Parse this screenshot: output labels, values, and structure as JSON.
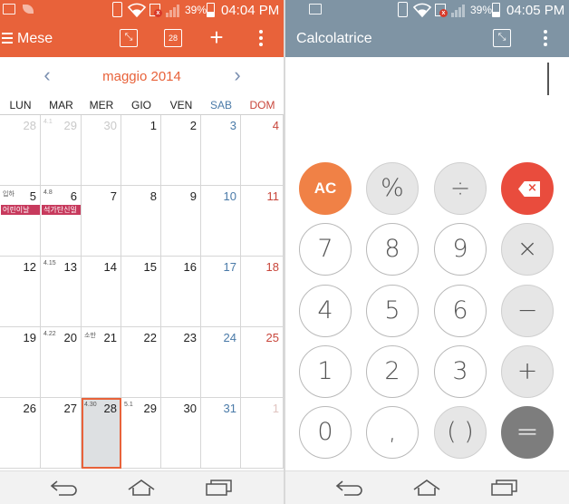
{
  "calendar_app": {
    "status": {
      "battery": "39%",
      "time": "04:04 PM"
    },
    "title": "Mese",
    "toolbar": {
      "today_badge": "28"
    },
    "month_label": "maggio 2014",
    "weekdays": [
      "LUN",
      "MAR",
      "MER",
      "GIO",
      "VEN",
      "SAB",
      "DOM"
    ],
    "weeks": [
      [
        {
          "d": "28",
          "other": true
        },
        {
          "d": "29",
          "other": true,
          "lunar": "4.1"
        },
        {
          "d": "30",
          "other": true
        },
        {
          "d": "1"
        },
        {
          "d": "2"
        },
        {
          "d": "3"
        },
        {
          "d": "4"
        }
      ],
      [
        {
          "d": "5",
          "lunar": "입하",
          "event": "어린이날"
        },
        {
          "d": "6",
          "lunar": "4.8",
          "event": "석가탄신일"
        },
        {
          "d": "7"
        },
        {
          "d": "8"
        },
        {
          "d": "9"
        },
        {
          "d": "10"
        },
        {
          "d": "11"
        }
      ],
      [
        {
          "d": "12"
        },
        {
          "d": "13",
          "lunar": "4.15"
        },
        {
          "d": "14"
        },
        {
          "d": "15"
        },
        {
          "d": "16"
        },
        {
          "d": "17"
        },
        {
          "d": "18"
        }
      ],
      [
        {
          "d": "19"
        },
        {
          "d": "20",
          "lunar": "4.22"
        },
        {
          "d": "21",
          "lunar": "소만"
        },
        {
          "d": "22"
        },
        {
          "d": "23"
        },
        {
          "d": "24"
        },
        {
          "d": "25"
        }
      ],
      [
        {
          "d": "26"
        },
        {
          "d": "27"
        },
        {
          "d": "28",
          "lunar": "4.30",
          "selected": true
        },
        {
          "d": "29",
          "lunar": "5.1"
        },
        {
          "d": "30"
        },
        {
          "d": "31"
        },
        {
          "d": "1",
          "other": true
        }
      ]
    ]
  },
  "calculator_app": {
    "status": {
      "battery": "39%",
      "time": "04:05 PM"
    },
    "title": "Calcolatrice",
    "display_value": "",
    "keys": [
      [
        {
          "label": "AC",
          "kind": "ac",
          "name": "clear"
        },
        {
          "label": "%",
          "kind": "op",
          "name": "percent"
        },
        {
          "label": "÷",
          "kind": "op",
          "name": "divide"
        },
        {
          "label": "",
          "kind": "del",
          "name": "backspace"
        }
      ],
      [
        {
          "label": "7",
          "kind": "num",
          "name": "7"
        },
        {
          "label": "8",
          "kind": "num",
          "name": "8"
        },
        {
          "label": "9",
          "kind": "num",
          "name": "9"
        },
        {
          "label": "×",
          "kind": "op",
          "name": "multiply"
        }
      ],
      [
        {
          "label": "4",
          "kind": "num",
          "name": "4"
        },
        {
          "label": "5",
          "kind": "num",
          "name": "5"
        },
        {
          "label": "6",
          "kind": "num",
          "name": "6"
        },
        {
          "label": "−",
          "kind": "op",
          "name": "minus"
        }
      ],
      [
        {
          "label": "1",
          "kind": "num",
          "name": "1"
        },
        {
          "label": "2",
          "kind": "num",
          "name": "2"
        },
        {
          "label": "3",
          "kind": "num",
          "name": "3"
        },
        {
          "label": "+",
          "kind": "op",
          "name": "plus"
        }
      ],
      [
        {
          "label": "0",
          "kind": "num",
          "name": "0"
        },
        {
          "label": ",",
          "kind": "num",
          "name": "comma"
        },
        {
          "label": "( )",
          "kind": "op",
          "name": "parentheses"
        },
        {
          "label": "=",
          "kind": "eq",
          "name": "equals"
        }
      ]
    ]
  },
  "colors": {
    "calendar_accent": "#e8623a",
    "calculator_accent": "#7f94a4",
    "saturday": "#4a7aa8",
    "sunday": "#c8463b",
    "event": "#c73a5d"
  },
  "icons": {
    "statusbar": [
      "picture-icon",
      "leaf-icon",
      "phone-icon",
      "wifi-icon",
      "sim-error-icon",
      "signal-icon",
      "battery-icon"
    ],
    "toolbar": [
      "collapse-icon",
      "calendar-today-icon",
      "plus-icon",
      "overflow-menu-icon"
    ],
    "navbar": [
      "back-icon",
      "home-icon",
      "recent-apps-icon"
    ]
  }
}
